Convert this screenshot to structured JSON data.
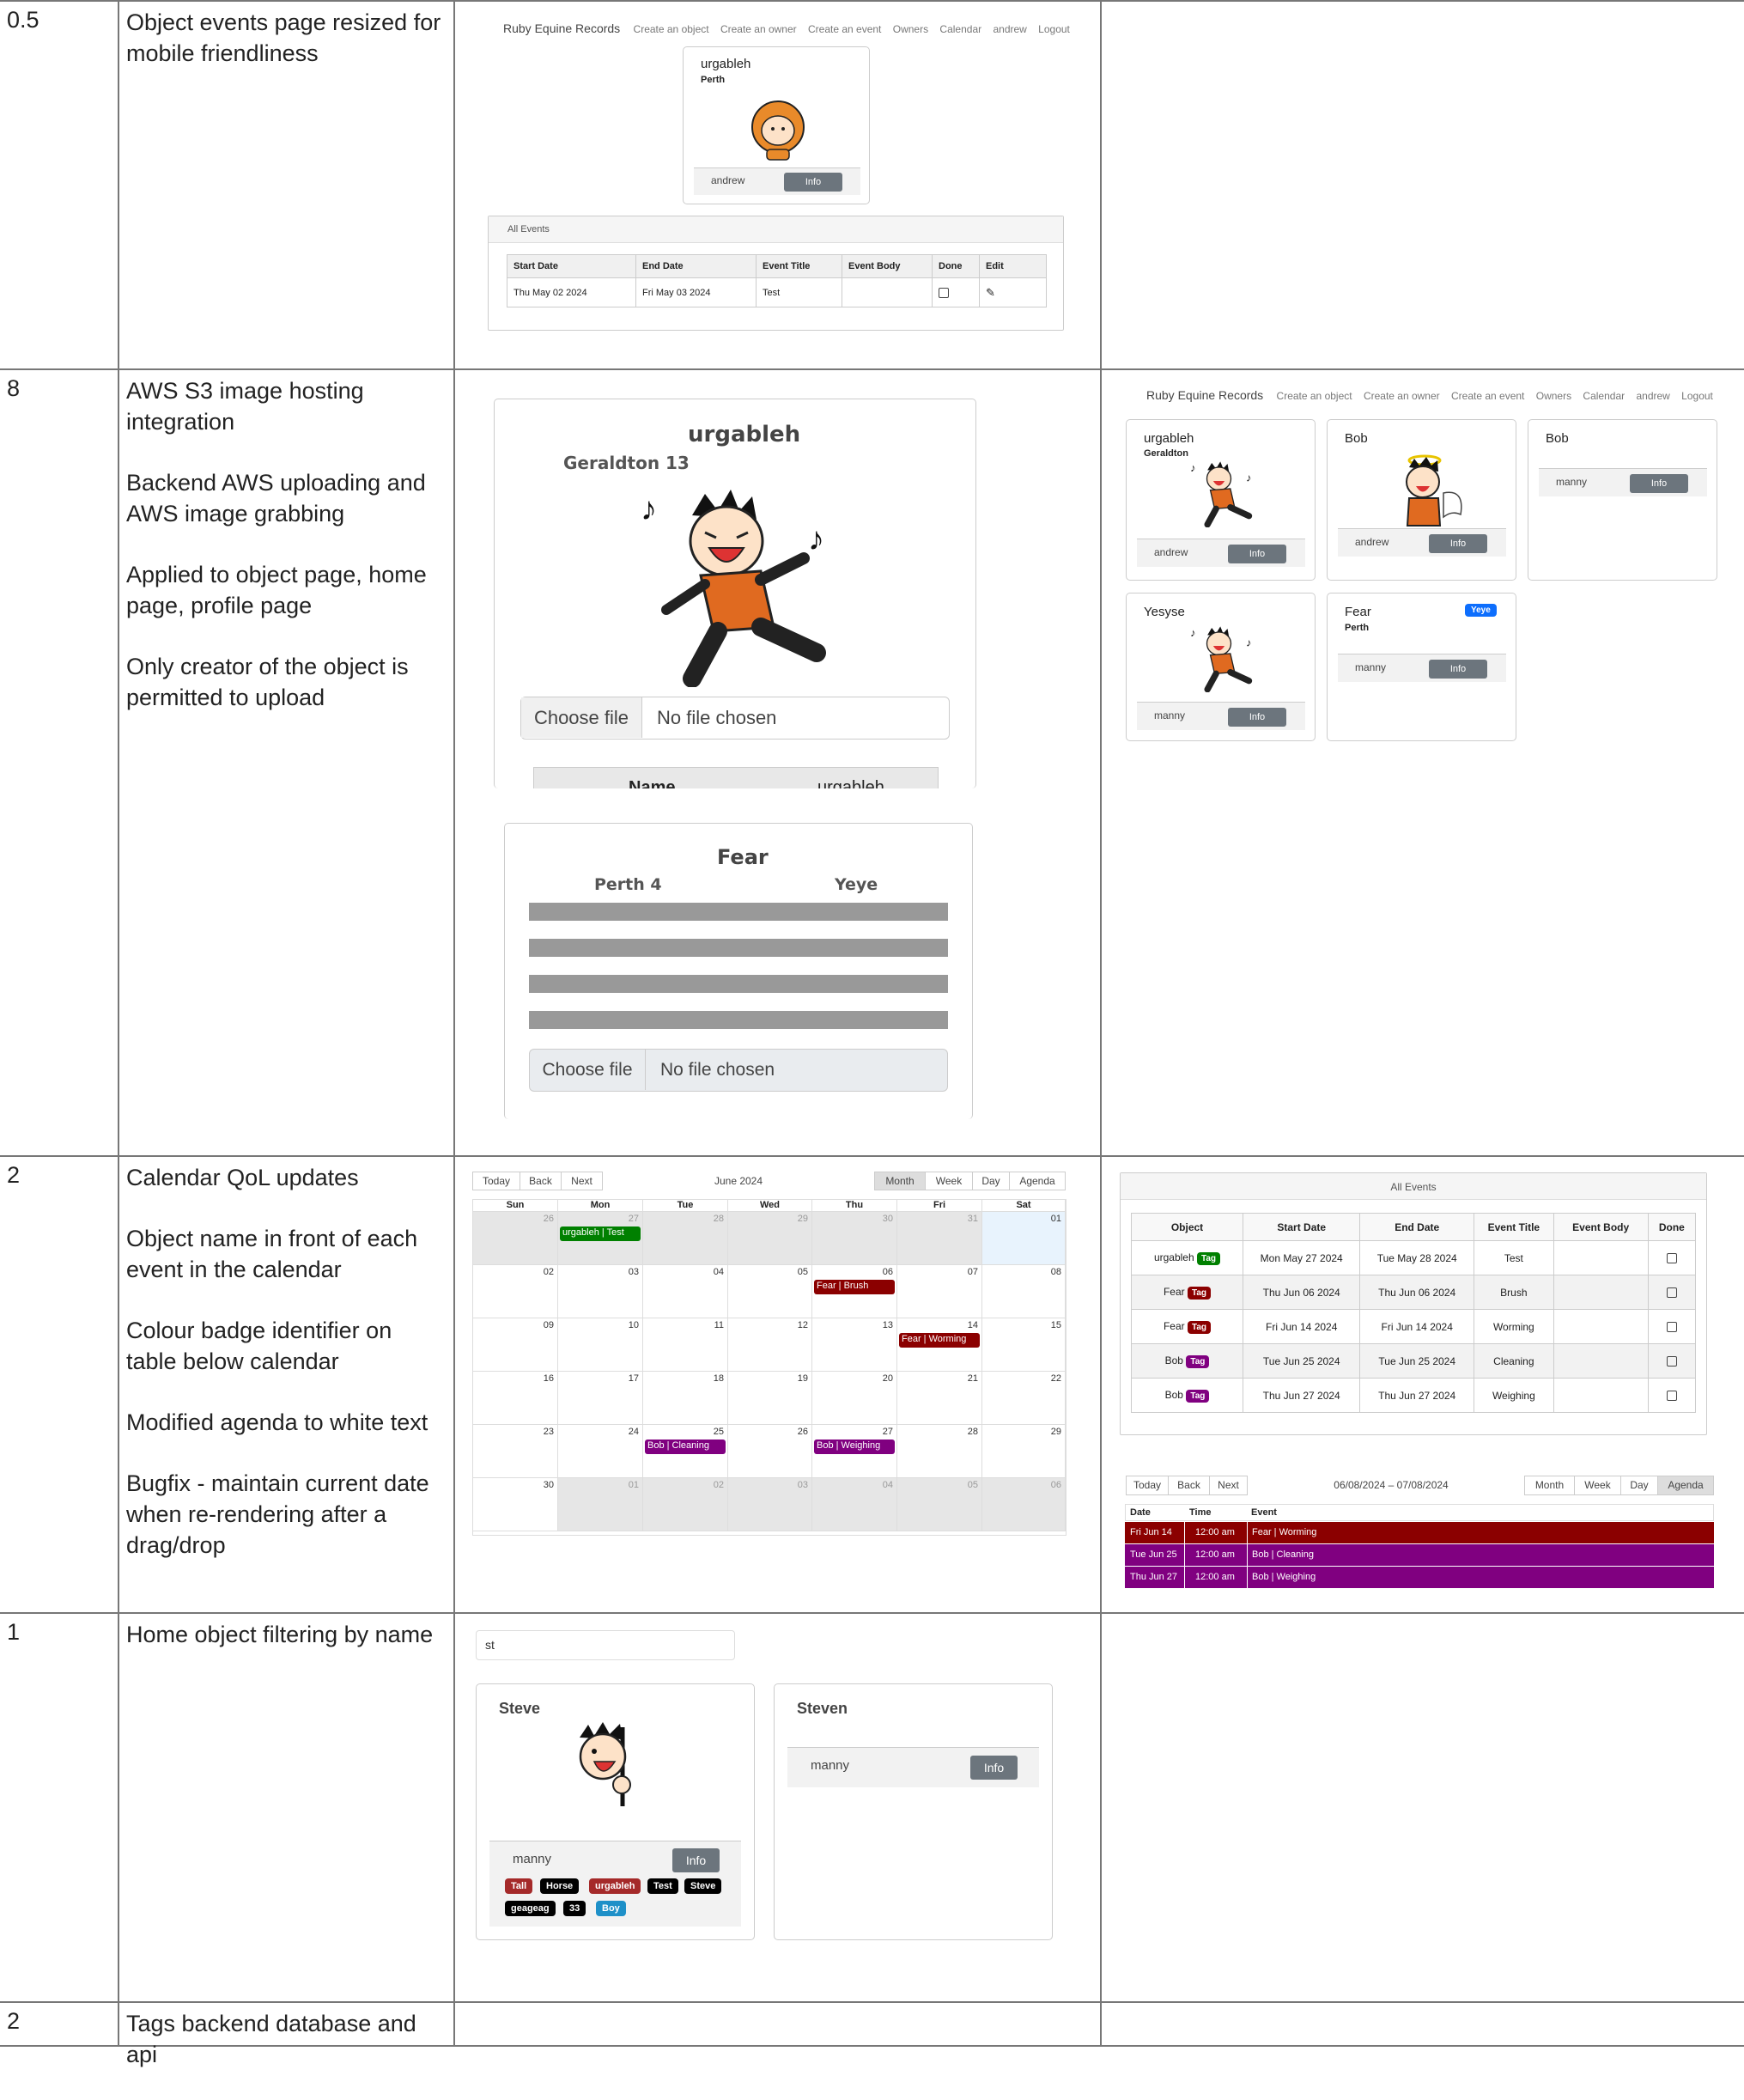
{
  "rows": [
    {
      "num": "0.5",
      "desc": [
        "Object events page resized for mobile friendliness"
      ]
    },
    {
      "num": "8",
      "desc": [
        "AWS S3 image hosting integration",
        "Backend AWS uploading and AWS image grabbing",
        "Applied to object page, home page, profile page",
        "Only creator of the object is permitted to upload"
      ]
    },
    {
      "num": "2",
      "desc": [
        "Calendar QoL updates",
        "Object name in front of each event in the calendar",
        "Colour badge identifier on table below calendar",
        "Modified agenda to white text",
        "Bugfix - maintain current date when re-rendering after a drag/drop"
      ]
    },
    {
      "num": "1",
      "desc": [
        "Home object filtering by name"
      ]
    },
    {
      "num": "2",
      "desc": [
        "Tags backend database and api"
      ]
    }
  ],
  "nav": {
    "brand": "Ruby Equine Records",
    "links": [
      "Create an object",
      "Create an owner",
      "Create an event",
      "Owners",
      "Calendar",
      "andrew",
      "Logout"
    ]
  },
  "row1": {
    "card": {
      "name": "urgableh",
      "location": "Perth",
      "owner": "andrew",
      "info": "Info"
    },
    "all_events": "All Events",
    "headers": [
      "Start Date",
      "End Date",
      "Event Title",
      "Event Body",
      "Done",
      "Edit"
    ],
    "row": [
      "Thu May 02 2024",
      "Fri May 03 2024",
      "Test",
      ""
    ]
  },
  "row2": {
    "object_card": {
      "name": "urgableh",
      "location": "Geraldton 13",
      "choose": "Choose file",
      "nofile": "No file chosen",
      "table_left": "Name",
      "table_right": "urgableh"
    },
    "fear_card": {
      "name": "Fear",
      "location": "Perth 4",
      "tag": "Yeye",
      "choose": "Choose file",
      "nofile": "No file chosen"
    },
    "home_cards": [
      {
        "name": "urgableh",
        "location": "Geraldton",
        "owner": "andrew",
        "info": "Info"
      },
      {
        "name": "Bob",
        "location": "",
        "owner": "andrew",
        "info": "Info"
      },
      {
        "name": "Bob",
        "location": "",
        "owner": "manny",
        "info": "Info"
      },
      {
        "name": "Yesyse",
        "location": "",
        "owner": "manny",
        "info": "Info"
      },
      {
        "name": "Fear",
        "location": "Perth",
        "owner": "manny",
        "info": "Info",
        "tag": "Yeye"
      }
    ]
  },
  "calendar": {
    "toolbar": {
      "today": "Today",
      "back": "Back",
      "next": "Next",
      "label": "June 2024",
      "views": [
        "Month",
        "Week",
        "Day",
        "Agenda"
      ],
      "active": "Month"
    },
    "days": [
      "Sun",
      "Mon",
      "Tue",
      "Wed",
      "Thu",
      "Fri",
      "Sat"
    ],
    "weeks": [
      [
        "26",
        "27",
        "28",
        "29",
        "30",
        "31",
        "01"
      ],
      [
        "02",
        "03",
        "04",
        "05",
        "06",
        "07",
        "08"
      ],
      [
        "09",
        "10",
        "11",
        "12",
        "13",
        "14",
        "15"
      ],
      [
        "16",
        "17",
        "18",
        "19",
        "20",
        "21",
        "22"
      ],
      [
        "23",
        "24",
        "25",
        "26",
        "27",
        "28",
        "29"
      ],
      [
        "30",
        "01",
        "02",
        "03",
        "04",
        "05",
        "06"
      ]
    ],
    "events": [
      {
        "week": 0,
        "day": 1,
        "label": "urgableh | Test",
        "color": "#008000"
      },
      {
        "week": 1,
        "day": 4,
        "label": "Fear | Brush",
        "color": "#8b0000"
      },
      {
        "week": 2,
        "day": 5,
        "label": "Fear | Worming",
        "color": "#8b0000"
      },
      {
        "week": 4,
        "day": 2,
        "label": "Bob | Cleaning",
        "color": "#800080"
      },
      {
        "week": 4,
        "day": 4,
        "label": "Bob | Weighing",
        "color": "#800080"
      }
    ]
  },
  "events_table": {
    "title": "All Events",
    "headers": [
      "Object",
      "Start Date",
      "End Date",
      "Event Title",
      "Event Body",
      "Done"
    ],
    "tag_label": "Tag",
    "rows": [
      {
        "object": "urgableh",
        "color": "#008000",
        "start": "Mon May 27 2024",
        "end": "Tue May 28 2024",
        "title": "Test",
        "body": ""
      },
      {
        "object": "Fear",
        "color": "#8b0000",
        "start": "Thu Jun 06 2024",
        "end": "Thu Jun 06 2024",
        "title": "Brush",
        "body": ""
      },
      {
        "object": "Fear",
        "color": "#8b0000",
        "start": "Fri Jun 14 2024",
        "end": "Fri Jun 14 2024",
        "title": "Worming",
        "body": ""
      },
      {
        "object": "Bob",
        "color": "#800080",
        "start": "Tue Jun 25 2024",
        "end": "Tue Jun 25 2024",
        "title": "Cleaning",
        "body": ""
      },
      {
        "object": "Bob",
        "color": "#800080",
        "start": "Thu Jun 27 2024",
        "end": "Thu Jun 27 2024",
        "title": "Weighing",
        "body": ""
      }
    ]
  },
  "agenda": {
    "toolbar": {
      "today": "Today",
      "back": "Back",
      "next": "Next",
      "label": "06/08/2024 – 07/08/2024",
      "views": [
        "Month",
        "Week",
        "Day",
        "Agenda"
      ],
      "active": "Agenda"
    },
    "headers": [
      "Date",
      "Time",
      "Event"
    ],
    "rows": [
      {
        "date": "Fri Jun 14",
        "time": "12:00 am",
        "event": "Fear | Worming",
        "color": "#8b0000"
      },
      {
        "date": "Tue Jun 25",
        "time": "12:00 am",
        "event": "Bob | Cleaning",
        "color": "#800080"
      },
      {
        "date": "Thu Jun 27",
        "time": "12:00 am",
        "event": "Bob | Weighing",
        "color": "#800080"
      }
    ]
  },
  "filter": {
    "query": "st",
    "cards": [
      {
        "name": "Steve",
        "owner": "manny",
        "info": "Info"
      },
      {
        "name": "Steven",
        "owner": "manny",
        "info": "Info"
      }
    ],
    "tags": [
      {
        "label": "Tall",
        "color": "#a52a2a"
      },
      {
        "label": "Horse",
        "color": "#000000"
      },
      {
        "label": "urgableh",
        "color": "#a52a2a"
      },
      {
        "label": "Test",
        "color": "#000000"
      },
      {
        "label": "Steve",
        "color": "#000000"
      },
      {
        "label": "geageag",
        "color": "#000000"
      },
      {
        "label": "33",
        "color": "#000000"
      },
      {
        "label": "Boy",
        "color": "#1e90c8"
      }
    ]
  }
}
